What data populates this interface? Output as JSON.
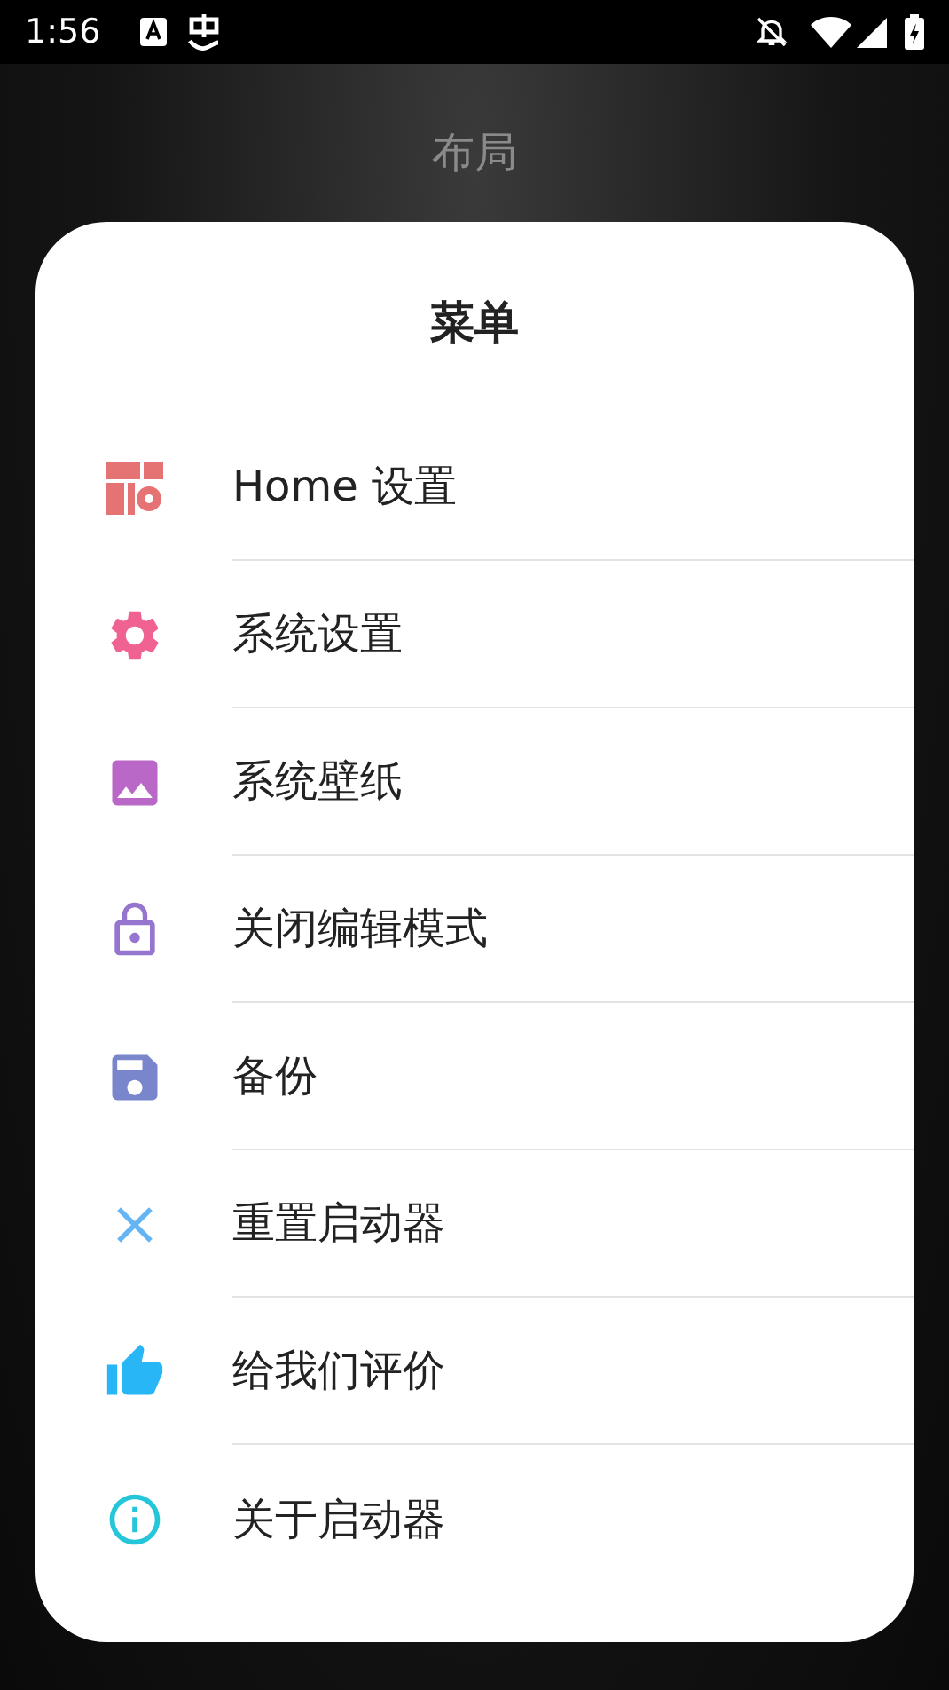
{
  "status_bar": {
    "time": "1:56"
  },
  "background_title": "布局",
  "menu": {
    "title": "菜单",
    "items": [
      {
        "kind": "home",
        "label": "Home 设置",
        "color": "#e57373"
      },
      {
        "kind": "gear",
        "label": "系统设置",
        "color": "#f06292"
      },
      {
        "kind": "image",
        "label": "系统壁纸",
        "color": "#ba68c8"
      },
      {
        "kind": "lock",
        "label": "关闭编辑模式",
        "color": "#9575cd"
      },
      {
        "kind": "save",
        "label": "备份",
        "color": "#7986cb"
      },
      {
        "kind": "close",
        "label": "重置启动器",
        "color": "#64b5f6"
      },
      {
        "kind": "thumb",
        "label": "给我们评价",
        "color": "#29b6f6"
      },
      {
        "kind": "info",
        "label": "关于启动器",
        "color": "#26c6da"
      }
    ]
  }
}
